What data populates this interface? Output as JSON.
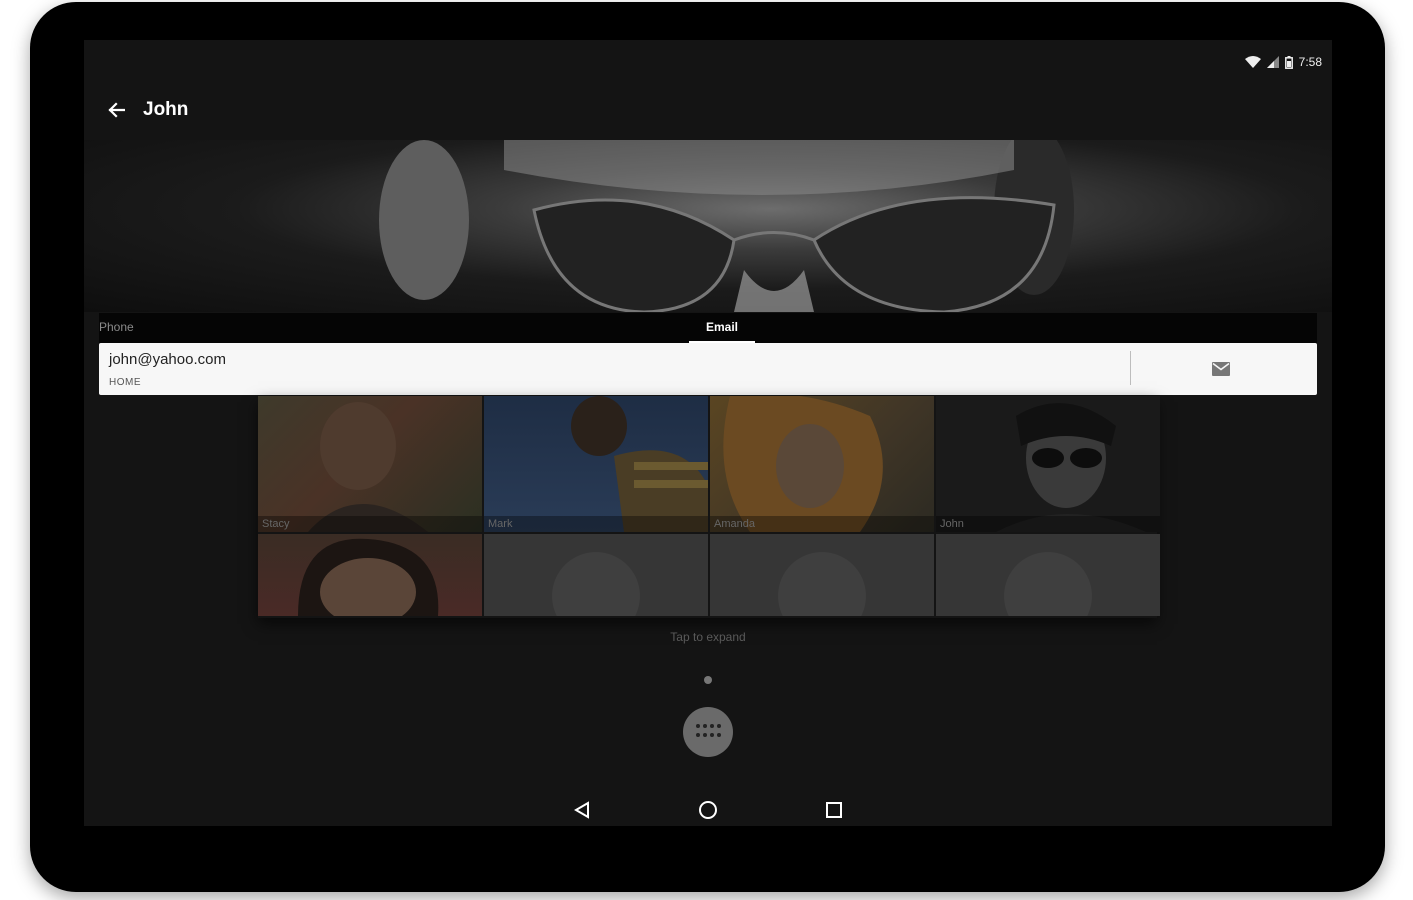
{
  "status_bar": {
    "time": "7:58"
  },
  "header": {
    "title": "John"
  },
  "tabs": [
    {
      "label": "Phone",
      "active": false
    },
    {
      "label": "Email",
      "active": true
    }
  ],
  "email": {
    "address": "john@yahoo.com",
    "type": "HOME"
  },
  "contacts": [
    {
      "name": "Stacy"
    },
    {
      "name": "Mark"
    },
    {
      "name": "Amanda"
    },
    {
      "name": "John"
    }
  ],
  "hint": "Tap to expand",
  "icons": {
    "back": "arrow-back-icon",
    "email_action": "email-icon",
    "app_drawer": "apps-icon",
    "nav": [
      "nav-back-icon",
      "nav-home-icon",
      "nav-recents-icon"
    ]
  },
  "colors": {
    "screen_bg": "#141414",
    "email_row_bg": "#f7f7f7",
    "bezel": "#000000"
  }
}
